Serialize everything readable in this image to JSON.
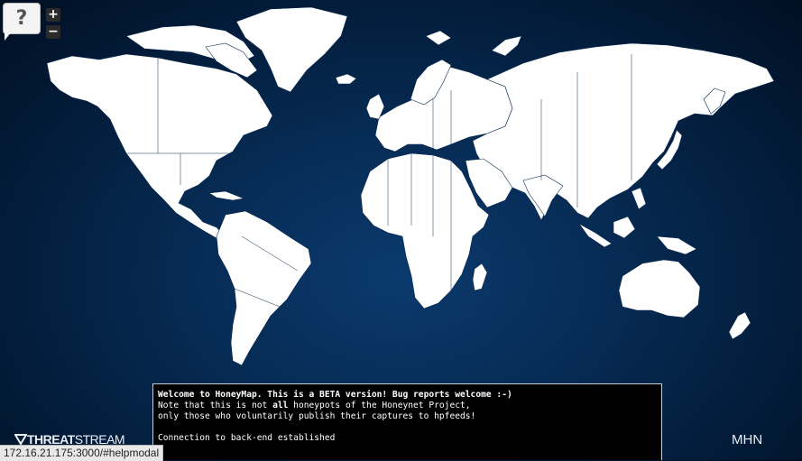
{
  "controls": {
    "help_label": "?",
    "zoom_in_label": "+",
    "zoom_out_label": "−"
  },
  "console": {
    "welcome": "Welcome to HoneyMap. This is a BETA version! Bug reports welcome :-)",
    "note_prefix": "Note that this is not ",
    "note_bold": "all",
    "note_suffix": " honeypots of the Honeynet Project,",
    "note_line2": "only those who voluntarily publish their captures to hpfeeds!",
    "status": "Connection to back-end established"
  },
  "branding": {
    "threatstream_bold": "THREAT",
    "threatstream_rest": "STREAM",
    "mhn": "MHN"
  },
  "status_bar": {
    "url": "172.16.21.175:3000/#helpmodal"
  },
  "colors": {
    "land": "#ffffff",
    "ocean": "#062a52",
    "console_bg": "#000000"
  }
}
